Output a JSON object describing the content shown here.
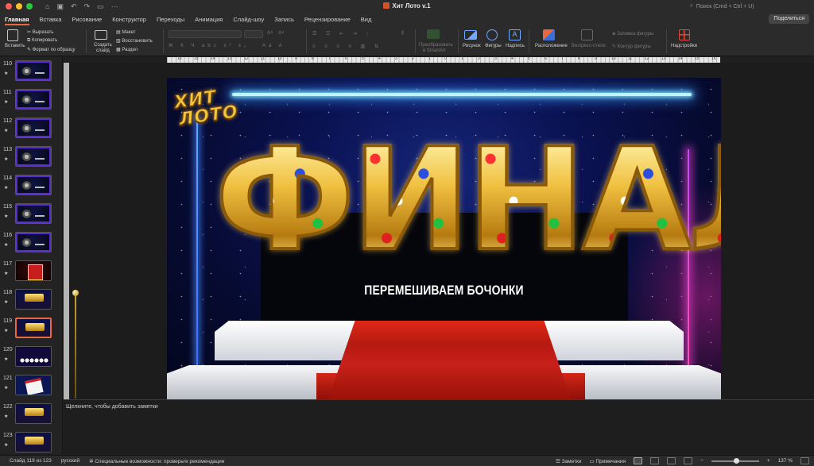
{
  "window": {
    "title": "Хит Лото v.1",
    "search_placeholder": "Поиск (Cmd + Ctrl + U)",
    "share_label": "Поделиться"
  },
  "tabs": [
    "Главная",
    "Вставка",
    "Рисование",
    "Конструктор",
    "Переходы",
    "Анимация",
    "Слайд-шоу",
    "Запись",
    "Рецензирование",
    "Вид"
  ],
  "active_tab": "Главная",
  "ribbon": {
    "paste": "Вставить",
    "cut": "Вырезать",
    "copy": "Копировать",
    "format_painter": "Формат по образцу",
    "new_slide_1": "Создать",
    "new_slide_2": "слайд",
    "layout": "Макет",
    "reset": "Восстановить",
    "section": "Раздел",
    "convert_smartart_1": "Преобразовать",
    "convert_smartart_2": "в SmartArt",
    "picture": "Рисунок",
    "shapes": "Фигуры",
    "textbox": "Надпись",
    "arrange": "Расположение",
    "quick_styles": "Экспресс-стили",
    "shape_fill": "Заливка фигуры",
    "shape_outline": "Контур фигуры",
    "addins": "Надстройки"
  },
  "ruler_labels": [
    "16",
    "15",
    "14",
    "13",
    "12",
    "11",
    "10",
    "9",
    "8",
    "7",
    "6",
    "5",
    "4",
    "3",
    "2",
    "1",
    "0",
    "1",
    "2",
    "3",
    "4",
    "5",
    "6",
    "7",
    "8",
    "9",
    "10",
    "11",
    "12",
    "13",
    "14",
    "15",
    "16"
  ],
  "thumbnails": [
    {
      "num": "110",
      "kind": "dark"
    },
    {
      "num": "111",
      "kind": "dark"
    },
    {
      "num": "112",
      "kind": "dark"
    },
    {
      "num": "113",
      "kind": "dark"
    },
    {
      "num": "114",
      "kind": "dark"
    },
    {
      "num": "115",
      "kind": "dark"
    },
    {
      "num": "116",
      "kind": "dark"
    },
    {
      "num": "117",
      "kind": "red"
    },
    {
      "num": "118",
      "kind": "gold"
    },
    {
      "num": "119",
      "kind": "gold",
      "selected": true
    },
    {
      "num": "120",
      "kind": "balls"
    },
    {
      "num": "121",
      "kind": "card"
    },
    {
      "num": "122",
      "kind": "gold"
    },
    {
      "num": "123",
      "kind": "gold"
    }
  ],
  "slide": {
    "logo_line1": "ХИТ",
    "logo_line2": "ЛОТО",
    "headline_letters": [
      "Ф",
      "И",
      "Н",
      "А",
      "Л"
    ],
    "subtitle": "ПЕРЕМЕШИВАЕМ БОЧОНКИ"
  },
  "notes_placeholder": "Щелкните, чтобы добавить заметки",
  "status": {
    "slide_counter": "Слайд 119 из 123",
    "language": "русский",
    "accessibility": "Специальные возможности: проверьте рекомендации",
    "notes": "Заметки",
    "comments": "Примечания",
    "zoom": "137 %"
  }
}
